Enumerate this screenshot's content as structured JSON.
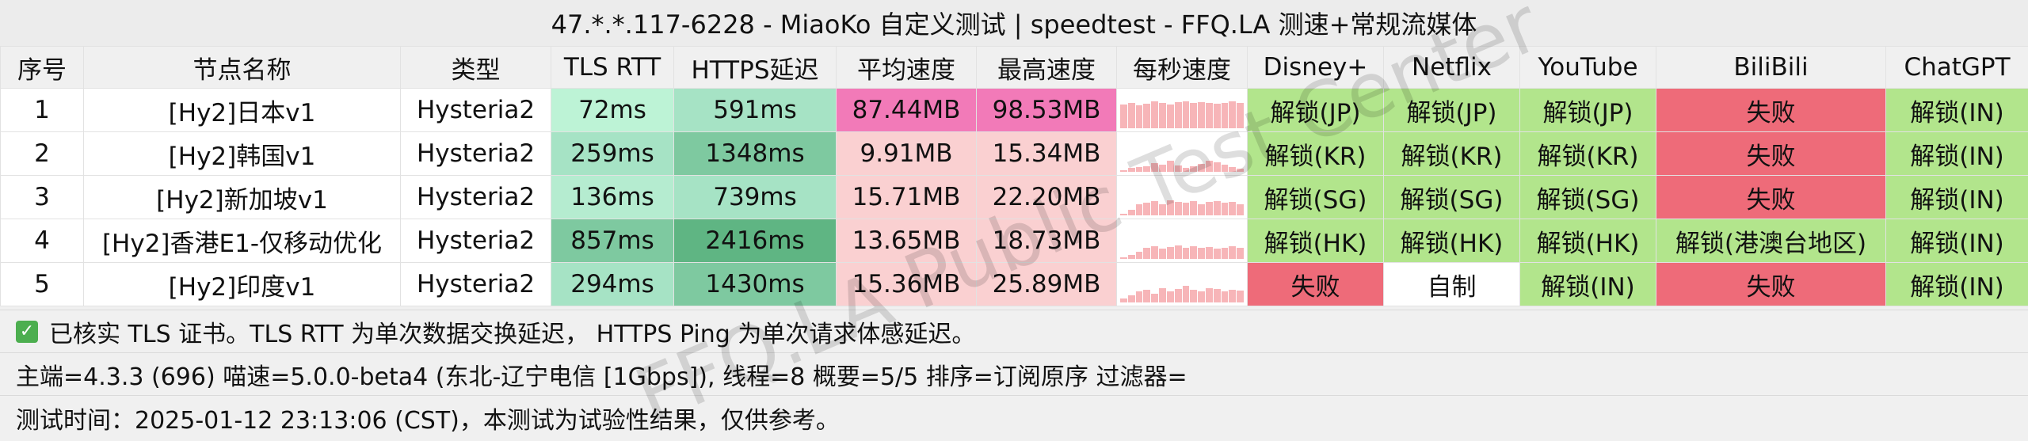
{
  "title": "47.*.*.117-6228 - MiaoKo 自定义测试 | speedtest - FFQ.LA 测速+常规流媒体",
  "watermark": "FFQ.LA Public Test Center",
  "columns": [
    "序号",
    "节点名称",
    "类型",
    "TLS RTT",
    "HTTPS延迟",
    "平均速度",
    "最高速度",
    "每秒速度",
    "Disney+",
    "Netflix",
    "YouTube",
    "BiliBili",
    "ChatGPT"
  ],
  "colors": {
    "unlock": "#b2e58c",
    "fail": "#ee6b79",
    "self": "#ffffff",
    "spark": "#f7b5b8"
  },
  "rows": [
    {
      "idx": "1",
      "name": "[Hy2]日本v1",
      "type": "Hysteria2",
      "tls_rtt": "72ms",
      "tls_bg": "#bdf3d6",
      "https": "591ms",
      "https_bg": "#a6e3c5",
      "avg": "87.44MB",
      "avg_bg": "#f27ab8",
      "max": "98.53MB",
      "max_bg": "#f27ab8",
      "spark": [
        0.65,
        0.7,
        0.62,
        0.68,
        0.75,
        0.7,
        0.66,
        0.72,
        0.74,
        0.69,
        0.71,
        0.7,
        0.68,
        0.7,
        0.73,
        0.7
      ],
      "disney": "解锁(JP)",
      "disney_s": "unlock",
      "netflix": "解锁(JP)",
      "netflix_s": "unlock",
      "youtube": "解锁(JP)",
      "youtube_s": "unlock",
      "bili": "失败",
      "bili_s": "fail",
      "chatgpt": "解锁(IN)",
      "chatgpt_s": "unlock"
    },
    {
      "idx": "2",
      "name": "[Hy2]韩国v1",
      "type": "Hysteria2",
      "tls_rtt": "259ms",
      "tls_bg": "#a6e3c5",
      "https": "1348ms",
      "https_bg": "#7ec9a0",
      "avg": "9.91MB",
      "avg_bg": "#fad0d1",
      "max": "15.34MB",
      "max_bg": "#fad0d1",
      "spark": [
        0.05,
        0.1,
        0.12,
        0.15,
        0.25,
        0.2,
        0.3,
        0.18,
        0.1,
        0.15,
        0.22,
        0.3,
        0.26,
        0.2,
        0.12,
        0.08
      ],
      "disney": "解锁(KR)",
      "disney_s": "unlock",
      "netflix": "解锁(KR)",
      "netflix_s": "unlock",
      "youtube": "解锁(KR)",
      "youtube_s": "unlock",
      "bili": "失败",
      "bili_s": "fail",
      "chatgpt": "解锁(IN)",
      "chatgpt_s": "unlock"
    },
    {
      "idx": "3",
      "name": "[Hy2]新加坡v1",
      "type": "Hysteria2",
      "tls_rtt": "136ms",
      "tls_bg": "#b5ecd0",
      "https": "739ms",
      "https_bg": "#a6e3c5",
      "avg": "15.71MB",
      "avg_bg": "#fad0d1",
      "max": "22.20MB",
      "max_bg": "#fad0d1",
      "spark": [
        0.05,
        0.15,
        0.3,
        0.35,
        0.4,
        0.3,
        0.42,
        0.38,
        0.35,
        0.4,
        0.3,
        0.36,
        0.4,
        0.34,
        0.38,
        0.3
      ],
      "disney": "解锁(SG)",
      "disney_s": "unlock",
      "netflix": "解锁(SG)",
      "netflix_s": "unlock",
      "youtube": "解锁(SG)",
      "youtube_s": "unlock",
      "bili": "失败",
      "bili_s": "fail",
      "chatgpt": "解锁(IN)",
      "chatgpt_s": "unlock"
    },
    {
      "idx": "4",
      "name": "[Hy2]香港E1-仅移动优化",
      "type": "Hysteria2",
      "tls_rtt": "857ms",
      "tls_bg": "#7ec9a0",
      "https": "2416ms",
      "https_bg": "#5fb583",
      "avg": "13.65MB",
      "avg_bg": "#fad0d1",
      "max": "18.73MB",
      "max_bg": "#fad0d1",
      "spark": [
        0.05,
        0.1,
        0.2,
        0.3,
        0.35,
        0.28,
        0.32,
        0.36,
        0.3,
        0.34,
        0.3,
        0.32,
        0.28,
        0.3,
        0.34,
        0.3
      ],
      "disney": "解锁(HK)",
      "disney_s": "unlock",
      "netflix": "解锁(HK)",
      "netflix_s": "unlock",
      "youtube": "解锁(HK)",
      "youtube_s": "unlock",
      "bili": "解锁(港澳台地区)",
      "bili_s": "unlock",
      "chatgpt": "解锁(IN)",
      "chatgpt_s": "unlock"
    },
    {
      "idx": "5",
      "name": "[Hy2]印度v1",
      "type": "Hysteria2",
      "tls_rtt": "294ms",
      "tls_bg": "#a6e3c5",
      "https": "1430ms",
      "https_bg": "#7ec9a0",
      "avg": "15.36MB",
      "avg_bg": "#fad0d1",
      "max": "25.89MB",
      "max_bg": "#fad0d1",
      "spark": [
        0.1,
        0.2,
        0.3,
        0.35,
        0.25,
        0.4,
        0.3,
        0.38,
        0.45,
        0.35,
        0.3,
        0.4,
        0.36,
        0.3,
        0.34,
        0.32
      ],
      "disney": "失败",
      "disney_s": "fail",
      "netflix": "自制",
      "netflix_s": "self",
      "youtube": "解锁(IN)",
      "youtube_s": "unlock",
      "bili": "失败",
      "bili_s": "fail",
      "chatgpt": "解锁(IN)",
      "chatgpt_s": "unlock"
    }
  ],
  "footer": {
    "tls_note": "已核实 TLS 证书。TLS RTT 为单次数据交换延迟，  HTTPS Ping 为单次请求体感延迟。",
    "version_line": "主端=4.3.3 (696) 喵速=5.0.0-beta4 (东北-辽宁电信 [1Gbps]), 线程=8 概要=5/5 排序=订阅原序 过滤器=",
    "time_line": "测试时间：2025-01-12 23:13:06 (CST)，本测试为试验性结果，仅供参考。"
  }
}
